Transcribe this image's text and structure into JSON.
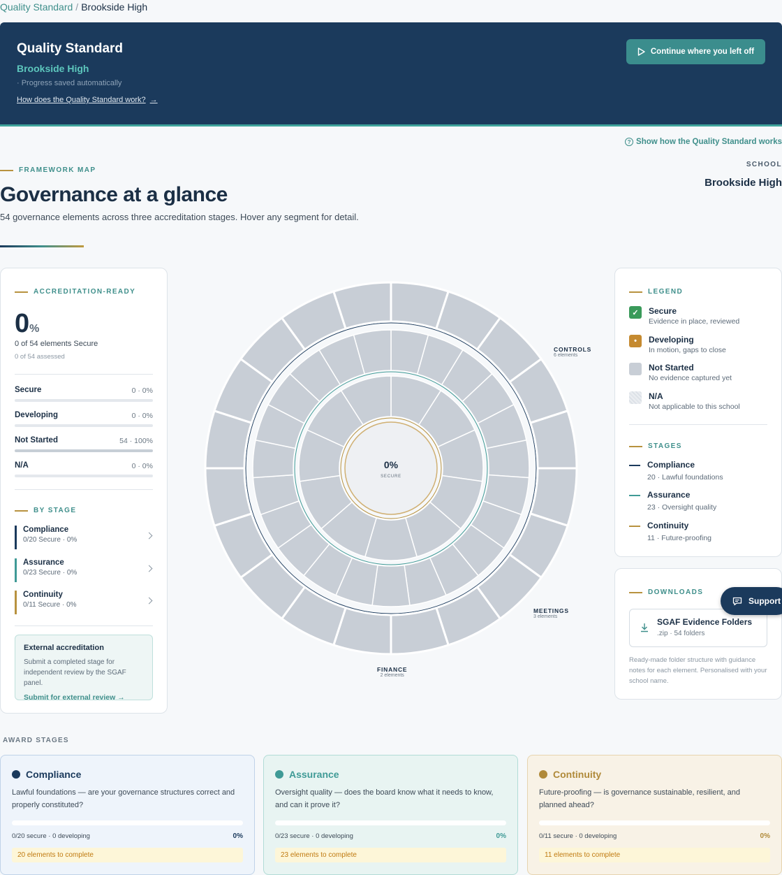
{
  "breadcrumb": {
    "root": "Quality Standard",
    "separator": "/",
    "current": "Brookside High"
  },
  "hero": {
    "title": "Quality Standard",
    "school": "Brookside High",
    "saved": "· Progress saved automatically",
    "how_link": "How does the Quality Standard work?",
    "arrow": "→",
    "continue_button": "Continue where you left off"
  },
  "show_how": "Show how the Quality Standard works",
  "framework": {
    "eyebrow": "FRAMEWORK MAP",
    "title": "Governance at a glance",
    "subtitle": "54 governance elements across three accreditation stages. Hover any segment for detail.",
    "school_label": "SCHOOL",
    "school_name": "Brookside High"
  },
  "summary": {
    "eyebrow": "ACCREDITATION-READY",
    "big_value": "0",
    "big_unit": "%",
    "secure_line": "0 of 54 elements Secure",
    "assessed_line": "0 of 54 assessed",
    "status_rows": [
      {
        "label": "Secure",
        "value": "0 · 0%",
        "fraction": 0
      },
      {
        "label": "Developing",
        "value": "0 · 0%",
        "fraction": 0
      },
      {
        "label": "Not Started",
        "value": "54 · 100%",
        "fraction": 1
      },
      {
        "label": "N/A",
        "value": "0 · 0%",
        "fraction": 0
      }
    ],
    "by_stage_eyebrow": "BY STAGE",
    "stages": [
      {
        "name": "Compliance",
        "detail": "0/20 Secure · 0%",
        "color": "#1b3a5c"
      },
      {
        "name": "Assurance",
        "detail": "0/23 Secure · 0%",
        "color": "#3f9a96"
      },
      {
        "name": "Continuity",
        "detail": "0/11 Secure · 0%",
        "color": "#b8923f"
      }
    ],
    "external": {
      "title": "External accreditation",
      "description": "Submit a completed stage for independent review by the SGAF panel.",
      "link": "Submit for external review →"
    }
  },
  "wheel": {
    "center_value": "0%",
    "center_label": "SECURE",
    "callouts": [
      {
        "name": "CONTROLS",
        "count": "6 elements"
      },
      {
        "name": "MEETINGS",
        "count": "3 elements"
      },
      {
        "name": "FINANCE",
        "count": "2 elements"
      }
    ],
    "colors": {
      "segment": "#c8ced6",
      "compliance": "#1b3a5c",
      "assurance": "#3f9a96",
      "continuity": "#b8923f"
    }
  },
  "legend": {
    "eyebrow": "LEGEND",
    "items": [
      {
        "name": "Secure",
        "desc": "Evidence in place, reviewed",
        "color": "#3a9a5a",
        "glyph": "✓"
      },
      {
        "name": "Developing",
        "desc": "In motion, gaps to close",
        "color": "#c58a30",
        "glyph": "•"
      },
      {
        "name": "Not Started",
        "desc": "No evidence captured yet",
        "color": "#c8ced6",
        "glyph": ""
      },
      {
        "name": "N/A",
        "desc": "Not applicable to this school",
        "color": "#eef0f3",
        "glyph": ""
      }
    ],
    "stages_eyebrow": "STAGES",
    "stages": [
      {
        "name": "Compliance",
        "desc": "20 · Lawful foundations",
        "color": "#1b3a5c"
      },
      {
        "name": "Assurance",
        "desc": "23 · Oversight quality",
        "color": "#3f9a96"
      },
      {
        "name": "Continuity",
        "desc": "11 · Future-proofing",
        "color": "#b8923f"
      }
    ]
  },
  "downloads": {
    "eyebrow": "DOWNLOADS",
    "file_title": "SGAF Evidence Folders",
    "file_meta": ".zip · 54 folders",
    "note": "Ready-made folder structure with guidance notes for each element. Personalised with your school name."
  },
  "support_button": "Support",
  "award": {
    "label": "AWARD STAGES",
    "cards": [
      {
        "name": "Compliance",
        "desc": "Lawful foundations — are your governance structures correct and properly constituted?",
        "stats": "0/20 secure · 0 developing",
        "percent": "0%",
        "todo": "20 elements to complete",
        "color": "#1b3a5c",
        "bg": "#eef4fb",
        "border": "#bfd2e8"
      },
      {
        "name": "Assurance",
        "desc": "Oversight quality — does the board know what it needs to know, and can it prove it?",
        "stats": "0/23 secure · 0 developing",
        "percent": "0%",
        "todo": "23 elements to complete",
        "color": "#3f9a96",
        "bg": "#e8f4f2",
        "border": "#b2dcd6"
      },
      {
        "name": "Continuity",
        "desc": "Future-proofing — is governance sustainable, resilient, and planned ahead?",
        "stats": "0/11 secure · 0 developing",
        "percent": "0%",
        "todo": "11 elements to complete",
        "color": "#b08a3a",
        "bg": "#f8f2e6",
        "border": "#e6d4af"
      }
    ]
  }
}
